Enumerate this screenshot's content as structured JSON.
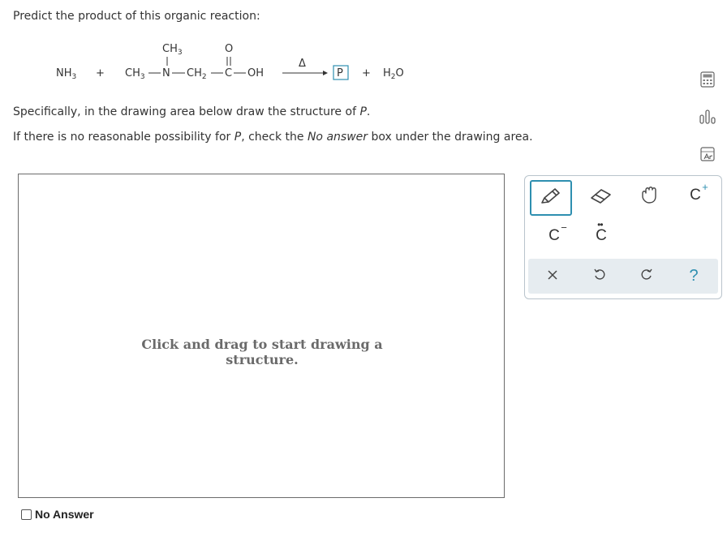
{
  "question": {
    "prompt": "Predict the product of this organic reaction:",
    "instruction_prefix": "Specifically, in the drawing area below draw the structure of ",
    "instruction_p": "P",
    "instruction_suffix": ".",
    "noanswer_text_a": "If there is no reasonable possibility for ",
    "noanswer_text_p": "P",
    "noanswer_text_b": ", check the ",
    "noanswer_text_em": "No answer",
    "noanswer_text_c": " box under the drawing area."
  },
  "reaction": {
    "reactant1_main": "NH",
    "reactant1_sub": "3",
    "plus": "+",
    "ch3_top_main": "CH",
    "ch3_top_sub": "3",
    "o_top": "O",
    "ch3_left_main": "CH",
    "ch3_left_sub": "3",
    "n": "N",
    "ch2_main": "CH",
    "ch2_sub": "2",
    "c": "C",
    "oh": "OH",
    "condition": "Δ",
    "product": "P",
    "plus2": "+",
    "water_h": "H",
    "water_sub": "2",
    "water_o": "O"
  },
  "canvas": {
    "hint_line1": "Click and drag to start drawing a",
    "hint_line2": "structure."
  },
  "no_answer": {
    "label": "No Answer",
    "checked": false
  },
  "toolbox": {
    "carbon_anion": "C",
    "carbon_anion_charge": "−",
    "carbon_lone_pair": "C",
    "carbon_lone_pair_dots": "••",
    "carbon_cation": "C",
    "carbon_cation_charge": "+",
    "help": "?",
    "accent": "#2e8fb0"
  },
  "icons": {
    "tool_icons": [
      "pencil-icon",
      "eraser-icon",
      "hand-icon",
      "close-icon",
      "undo-icon",
      "redo-icon"
    ],
    "side_icons": [
      "calculator-icon",
      "chart-icon",
      "periodic-table-icon"
    ]
  }
}
